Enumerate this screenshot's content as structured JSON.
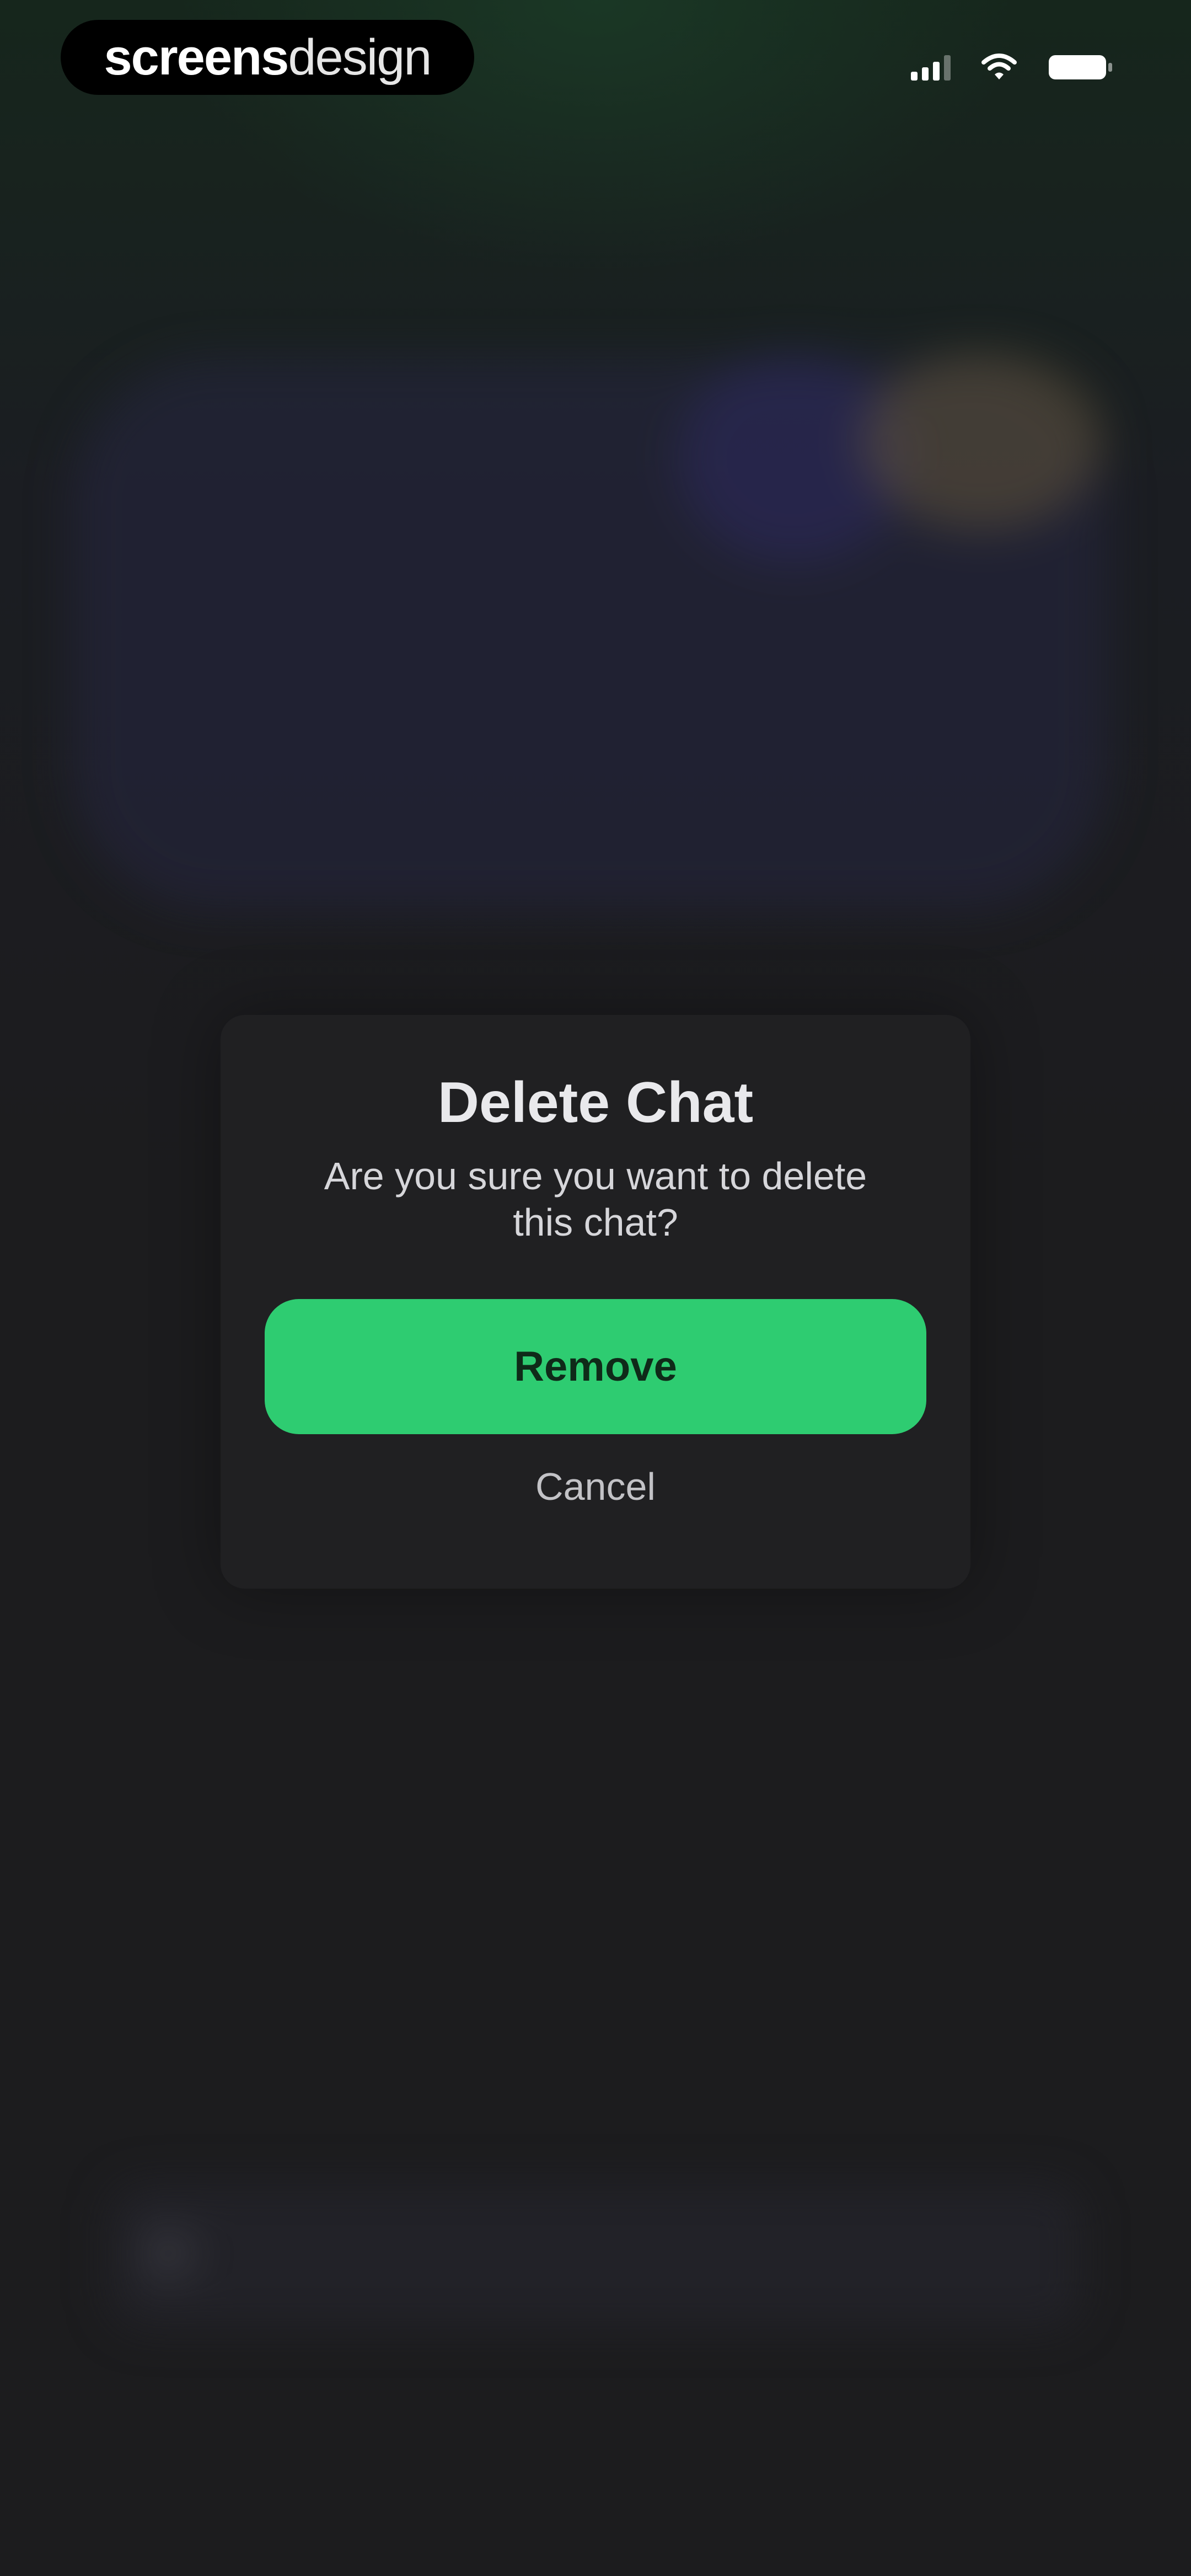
{
  "status_bar": {
    "brand_bold": "screens",
    "brand_light": "design",
    "signal_icon": "signal-icon",
    "wifi_icon": "wifi-icon",
    "battery_icon": "battery-icon"
  },
  "dialog": {
    "title": "Delete Chat",
    "message": "Are you sure you want to delete this chat?",
    "primary_label": "Remove",
    "secondary_label": "Cancel"
  },
  "colors": {
    "accent": "#2ecc71",
    "dialog_bg": "#202022",
    "page_bg": "#1c1c1e"
  }
}
